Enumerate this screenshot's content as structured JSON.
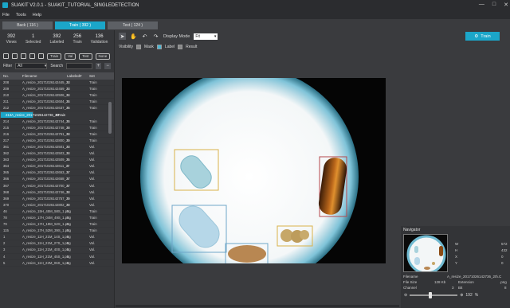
{
  "window": {
    "title": "SUAKIT V2.0.1 - SUAKIT_TUTORIAL_SINGLEDETECTION",
    "controls": [
      "—",
      "□",
      "✕"
    ]
  },
  "menu": [
    "File",
    "Tools",
    "Help"
  ],
  "tabs": [
    {
      "label": "Back ( 116 )"
    },
    {
      "label": "Train ( 392 )"
    },
    {
      "label": "Test ( 124 )"
    }
  ],
  "stats": [
    {
      "value": "392",
      "label": "Views"
    },
    {
      "value": "1",
      "label": "Selected"
    },
    {
      "value": "392",
      "label": "Labeled"
    },
    {
      "value": "256",
      "label": "Train"
    },
    {
      "value": "136",
      "label": "Validation"
    }
  ],
  "tool_pills": [
    "Train",
    "Val",
    "Test",
    "None"
  ],
  "filter": {
    "label": "Filter",
    "value": "All",
    "search_label": "Search",
    "plus": "+",
    "minus": "−"
  },
  "table": {
    "headers": [
      "No.",
      "Filename",
      "Labeled#",
      "Set"
    ],
    "rows": [
      [
        "208",
        "A_resize_20171026142445_23",
        "5",
        "Train"
      ],
      [
        "209",
        "A_resize_20171026142459_23",
        "5",
        "Train"
      ],
      [
        "210",
        "A_resize_20171026142506_24",
        "5",
        "Train"
      ],
      [
        "211",
        "A_resize_20171026142604_26",
        "5",
        "Train"
      ],
      [
        "212",
        "A_resize_20171026142637_26",
        "5",
        "Train"
      ],
      [
        "213",
        "A_resize_20171026142736_20",
        "5",
        "Train"
      ],
      [
        "214",
        "A_resize_20171026142744_26",
        "5",
        "Train"
      ],
      [
        "215",
        "A_resize_20171026142748_28",
        "5",
        "Train"
      ],
      [
        "216",
        "A_resize_20171026142751_28",
        "5",
        "Train"
      ],
      [
        "217",
        "A_resize_20171026142800_29",
        "5",
        "Train"
      ],
      [
        "361",
        "A_resize_20171026142501_23",
        "5",
        "Val."
      ],
      [
        "362",
        "A_resize_20171026142503_24",
        "5",
        "Val."
      ],
      [
        "363",
        "A_resize_20171026142509_25",
        "5",
        "Val."
      ],
      [
        "364",
        "A_resize_20171026142611_27",
        "5",
        "Val."
      ],
      [
        "365",
        "A_resize_20171026142653_27",
        "5",
        "Val."
      ],
      [
        "366",
        "A_resize_20171026142658_27",
        "5",
        "Val."
      ],
      [
        "367",
        "A_resize_20171026142700_27",
        "5",
        "Val."
      ],
      [
        "368",
        "A_resize_20171026142746_28",
        "5",
        "Val."
      ],
      [
        "369",
        "A_resize_20171026142757_29",
        "5",
        "Val."
      ],
      [
        "370",
        "A_resize_20171026142802_29",
        "5",
        "Val."
      ],
      [
        "46",
        "A_resize_15H_45M_58S_1.png",
        "5",
        "Train"
      ],
      [
        "78",
        "A_resize_17H_04M_49S_1.png",
        "5",
        "Train"
      ],
      [
        "79",
        "A_resize_17H_18M_52S_1.png",
        "5",
        "Train"
      ],
      [
        "115",
        "A_resize_17H_52M_39S_1.png",
        "5",
        "Train"
      ],
      [
        "1",
        "A_resize_11H_21M_14S_1.png",
        "5",
        "Val."
      ],
      [
        "2",
        "A_resize_11H_21M_27S_1.png",
        "5",
        "Val."
      ],
      [
        "3",
        "A_resize_11H_21M_40S_1.png",
        "5",
        "Val."
      ],
      [
        "4",
        "A_resize_11H_21M_45S_1.png",
        "5",
        "Val."
      ],
      [
        "5",
        "A_resize_11H_22M_06S_1.png",
        "5",
        "Val."
      ]
    ],
    "selected_index": 5
  },
  "toolbar": {
    "display_mode_label": "Display Mode",
    "display_mode_value": "Fit",
    "train_label": "Train"
  },
  "visibility": {
    "label": "Visibility",
    "items": [
      {
        "label": "Mask",
        "checked": false
      },
      {
        "label": "Label",
        "checked": true
      },
      {
        "label": "Result",
        "checked": false
      }
    ]
  },
  "navigator": {
    "title": "Navigator",
    "coords": [
      {
        "k": "W",
        "v": "572"
      },
      {
        "k": "H",
        "v": "432"
      },
      {
        "k": "X",
        "v": "0"
      },
      {
        "k": "Y",
        "v": "0"
      }
    ],
    "info": [
      {
        "k": "Filename",
        "v": "A_resize_20171026142736_20\\.C"
      },
      {
        "k": "File Size",
        "v": "128 Kb"
      },
      {
        "k": "Extension",
        "v": ".png"
      },
      {
        "k": "Channel",
        "v": "3"
      },
      {
        "k": "Bit",
        "v": "8"
      }
    ],
    "zoom_value": "192",
    "zoom_unit": "%",
    "zoom_fraction": 0.43
  },
  "colors": {
    "accent": "#1ba6c9",
    "box_yellow": "#d9b24a",
    "box_blue": "#6fa7c9",
    "box_red": "#b5484d"
  }
}
